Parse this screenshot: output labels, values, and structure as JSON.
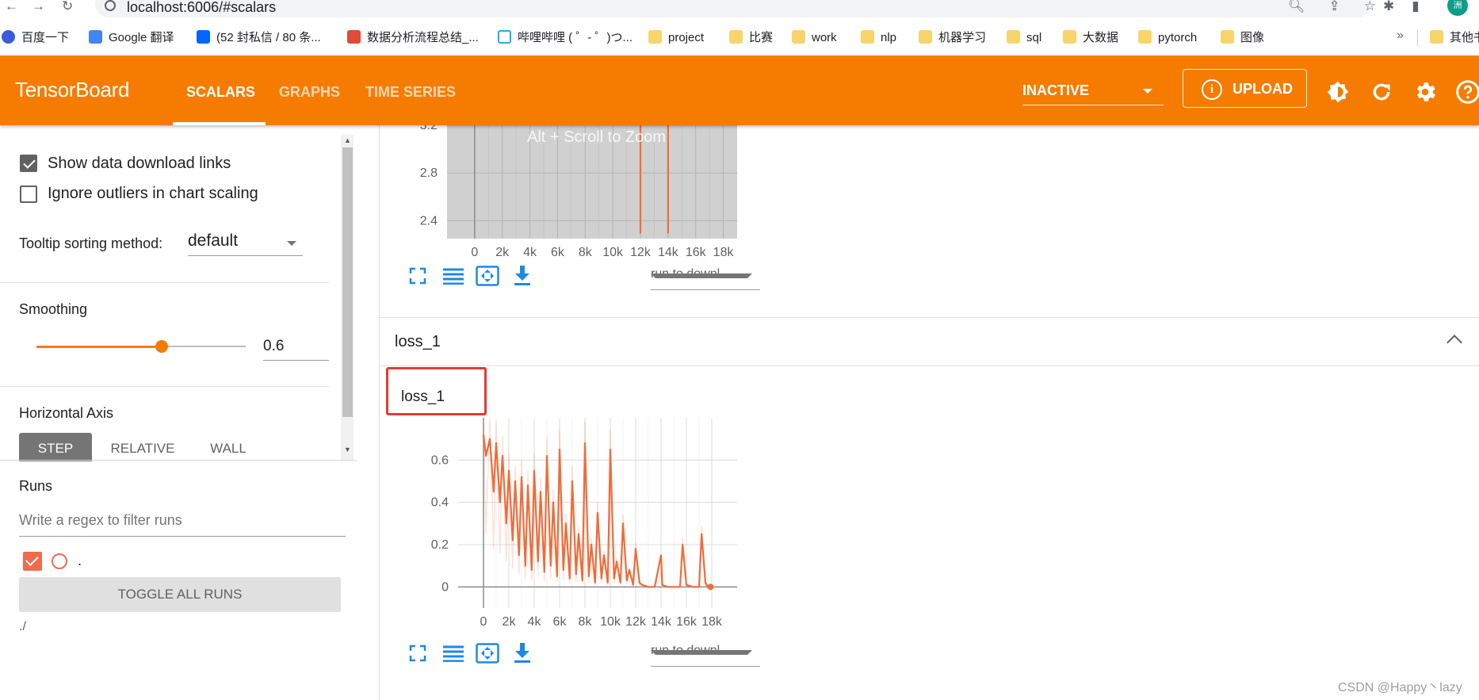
{
  "browser": {
    "url": "localhost:6006/#scalars",
    "bookmarks": [
      "百度一下",
      "Google 翻译",
      "(52 封私信 / 80 条...",
      "数据分析流程总结_...",
      "哔哩哔哩 ( ゜- ゜)つ...",
      "project",
      "比赛",
      "work",
      "nlp",
      "机器学习",
      "sql",
      "大数据",
      "pytorch",
      "图像",
      "其他书"
    ],
    "more": "»",
    "avatar": "洲"
  },
  "header": {
    "brand": "TensorBoard",
    "tabs": [
      "SCALARS",
      "GRAPHS",
      "TIME SERIES"
    ],
    "active_tab": "SCALARS",
    "run_status": "INACTIVE",
    "upload_label": "UPLOAD",
    "upload_glyph": "i",
    "accent": "#f57c00"
  },
  "sidebar": {
    "show_download_links": "Show data download links",
    "ignore_outliers": "Ignore outliers in chart scaling",
    "tooltip_label": "Tooltip sorting method:",
    "tooltip_value": "default",
    "smoothing_label": "Smoothing",
    "smoothing_value": "0.6",
    "smoothing": 0.6,
    "haxis_label": "Horizontal Axis",
    "haxis_options": [
      "STEP",
      "RELATIVE",
      "WALL"
    ],
    "runs_label": "Runs",
    "runs_filter_placeholder": "Write a regex to filter runs",
    "run_name": ".",
    "toggle_all": "TOGGLE ALL RUNS",
    "logdir": "./"
  },
  "main": {
    "zoom_hint": "Alt + Scroll to Zoom",
    "run_download_placeholder": "run to downl...",
    "group_title": "loss_1",
    "card_title": "loss_1"
  },
  "chart_data": [
    {
      "type": "line",
      "title": "",
      "note": "partially scrolled out of view",
      "x_ticks": [
        "0",
        "2k",
        "4k",
        "6k",
        "8k",
        "10k",
        "12k",
        "14k",
        "16k",
        "18k"
      ],
      "y_ticks": [
        "2.4",
        "2.8",
        "3.2"
      ],
      "ylim": [
        2.25,
        3.2
      ],
      "xlim": [
        -2000,
        19000
      ],
      "series": [
        {
          "x": [
            0,
            12000,
            12000,
            12000,
            14000,
            14000,
            14000
          ],
          "y": [
            3.3,
            3.3,
            2.3,
            3.3,
            3.3,
            2.3,
            3.3
          ]
        }
      ]
    },
    {
      "type": "line",
      "title": "loss_1",
      "x_ticks": [
        "0",
        "2k",
        "4k",
        "6k",
        "8k",
        "10k",
        "12k",
        "14k",
        "16k",
        "18k"
      ],
      "y_ticks": [
        "0",
        "0.2",
        "0.4",
        "0.6"
      ],
      "ylim": [
        -0.1,
        0.8
      ],
      "xlim": [
        -2000,
        20000
      ],
      "series": [
        {
          "x": [
            0,
            200,
            500,
            800,
            1000,
            1300,
            1500,
            1800,
            2000,
            2300,
            2500,
            2800,
            3000,
            3300,
            3500,
            3800,
            4000,
            4300,
            4500,
            4800,
            5000,
            5300,
            5500,
            5800,
            6000,
            6300,
            6500,
            6800,
            7000,
            7300,
            7500,
            7800,
            8000,
            8300,
            8500,
            8800,
            9000,
            9300,
            9500,
            9800,
            10000,
            10300,
            10500,
            10800,
            11000,
            11300,
            11500,
            11800,
            12000,
            12300,
            12500,
            13000,
            13500,
            14000,
            14100,
            14500,
            15000,
            15500,
            15700,
            16000,
            16500,
            17000,
            17200,
            17500,
            17700,
            17900
          ],
          "y": [
            0.72,
            0.62,
            0.7,
            0.45,
            0.68,
            0.4,
            0.62,
            0.3,
            0.55,
            0.22,
            0.5,
            0.15,
            0.52,
            0.1,
            0.48,
            0.08,
            0.55,
            0.12,
            0.45,
            0.07,
            0.62,
            0.1,
            0.4,
            0.05,
            0.65,
            0.08,
            0.3,
            0.04,
            0.5,
            0.06,
            0.25,
            0.03,
            0.68,
            0.05,
            0.2,
            0.02,
            0.35,
            0.04,
            0.15,
            0.02,
            0.65,
            0.04,
            0.12,
            0.02,
            0.3,
            0.03,
            0.08,
            0.01,
            0.18,
            0.02,
            0.01,
            0.0,
            0.0,
            0.15,
            0.01,
            0.0,
            0.0,
            0.0,
            0.2,
            0.01,
            0.0,
            0.0,
            0.25,
            0.02,
            0.0,
            0.0
          ]
        }
      ]
    }
  ]
}
